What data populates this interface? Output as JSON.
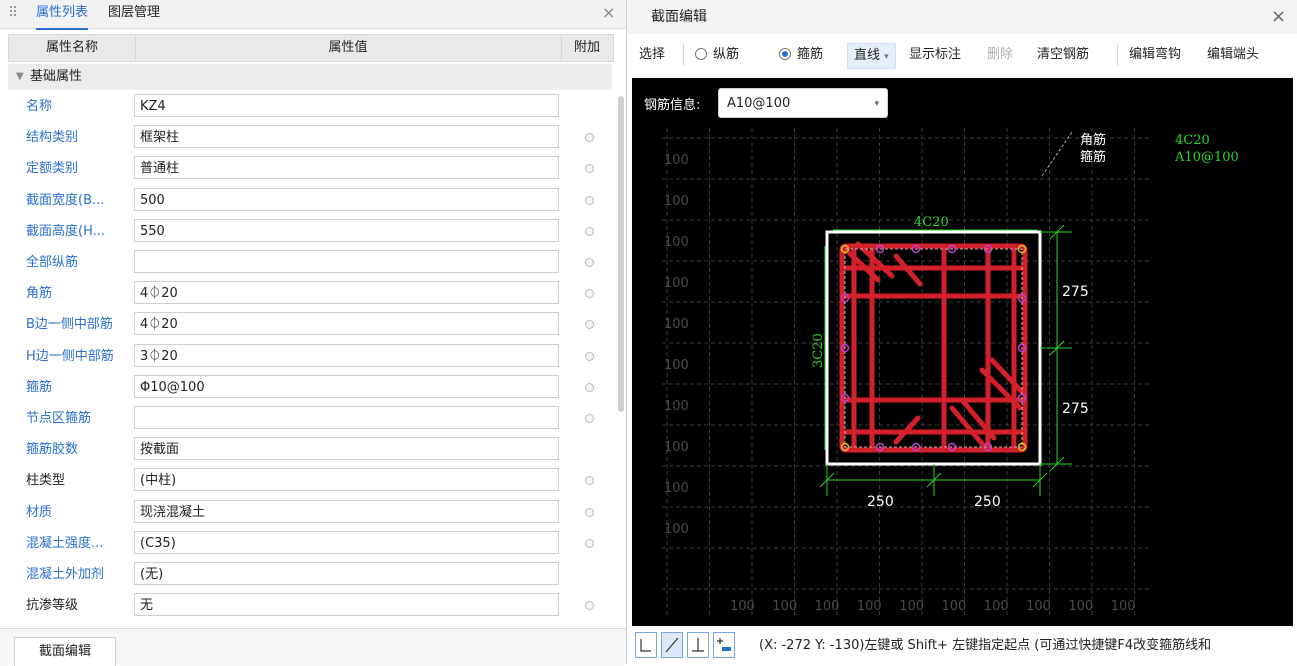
{
  "left_panel": {
    "tabs": [
      "属性列表",
      "图层管理"
    ],
    "close_glyph": "×",
    "columns": [
      "属性名称",
      "属性值",
      "附加"
    ],
    "group": "基础属性",
    "rows": [
      {
        "name": "名称",
        "value": "KZ4",
        "has_dot": false,
        "color": "blue"
      },
      {
        "name": "结构类别",
        "value": "框架柱",
        "has_dot": true,
        "color": "blue"
      },
      {
        "name": "定额类别",
        "value": "普通柱",
        "has_dot": true,
        "color": "blue"
      },
      {
        "name": "截面宽度(B...",
        "value": "500",
        "has_dot": true,
        "color": "blue"
      },
      {
        "name": "截面高度(H...",
        "value": "550",
        "has_dot": true,
        "color": "blue"
      },
      {
        "name": "全部纵筋",
        "value": "",
        "has_dot": true,
        "color": "blue"
      },
      {
        "name": "角筋",
        "value": "4⏀20",
        "has_dot": true,
        "color": "blue"
      },
      {
        "name": "B边一侧中部筋",
        "value": "4⏀20",
        "has_dot": true,
        "color": "blue"
      },
      {
        "name": "H边一侧中部筋",
        "value": "3⏀20",
        "has_dot": true,
        "color": "blue"
      },
      {
        "name": "箍筋",
        "value": "Φ10@100",
        "has_dot": true,
        "color": "blue"
      },
      {
        "name": "节点区箍筋",
        "value": "",
        "has_dot": true,
        "color": "blue"
      },
      {
        "name": "箍筋胶数",
        "value": "按截面",
        "has_dot": false,
        "color": "blue"
      },
      {
        "name": "柱类型",
        "value": "(中柱)",
        "has_dot": true,
        "color": "dark"
      },
      {
        "name": "材质",
        "value": "现浇混凝土",
        "has_dot": true,
        "color": "blue"
      },
      {
        "name": "混凝土强度...",
        "value": "(C35)",
        "has_dot": true,
        "color": "blue"
      },
      {
        "name": "混凝土外加剂",
        "value": "(无)",
        "has_dot": false,
        "color": "blue"
      },
      {
        "name": "抗渗等级",
        "value": "无",
        "has_dot": true,
        "color": "dark"
      }
    ],
    "bottom_button": "截面编辑"
  },
  "dialog": {
    "title": "截面编辑",
    "close_glyph": "×",
    "toolbar": {
      "select": "选择",
      "radio_longitudinal": "纵筋",
      "radio_stirrup": "箍筋",
      "line_mode": "直线",
      "line_caret": "▾",
      "show_dims": "显示标注",
      "delete": "删除",
      "clear_rebar": "清空钢筋",
      "edit_hook": "编辑弯钩",
      "edit_end": "编辑端头"
    },
    "rebar_info_label": "钢筋信息:",
    "rebar_info_value": "A10@100",
    "select_caret": "▾",
    "drawing": {
      "legend": [
        {
          "label": "角筋",
          "value": "4C20"
        },
        {
          "label": "箍筋",
          "value": "A10@100"
        }
      ],
      "top_label": "4C20",
      "left_label": "3C20",
      "dim_right": [
        "275",
        "275"
      ],
      "dim_bottom": [
        "250",
        "250"
      ],
      "grid_label": "100",
      "colors": {
        "rebar": "#d3202a",
        "green": "#2bd42b",
        "dot": "#c040d0",
        "white": "#ffffff"
      }
    },
    "status_text": "(X: -272 Y: -130)左键或 Shift+ 左键指定起点 (可通过快捷键F4改变箍筋线和"
  }
}
